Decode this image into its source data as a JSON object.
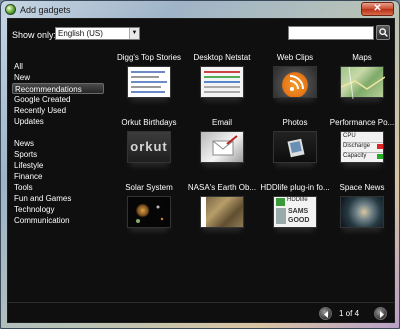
{
  "window": {
    "title": "Add gadgets",
    "close_glyph": "✕"
  },
  "toolbar": {
    "show_only_label": "Show only:",
    "language_value": "English (US)",
    "search_value": "",
    "search_icon": "magnifier-icon"
  },
  "categories": [
    {
      "label": "All",
      "active": false
    },
    {
      "label": "New",
      "active": false
    },
    {
      "label": "Recommendations",
      "active": true
    },
    {
      "label": "Google Created",
      "active": false
    },
    {
      "label": "Recently Used",
      "active": false
    },
    {
      "label": "Updates",
      "active": false
    },
    {
      "label": "News",
      "active": false
    },
    {
      "label": "Sports",
      "active": false
    },
    {
      "label": "Lifestyle",
      "active": false
    },
    {
      "label": "Finance",
      "active": false
    },
    {
      "label": "Tools",
      "active": false
    },
    {
      "label": "Fun and Games",
      "active": false
    },
    {
      "label": "Technology",
      "active": false
    },
    {
      "label": "Communication",
      "active": false
    }
  ],
  "gadgets": [
    {
      "name": "Digg's Top Stories"
    },
    {
      "name": "Desktop Netstat"
    },
    {
      "name": "Web Clips"
    },
    {
      "name": "Maps"
    },
    {
      "name": "Orkut Birthdays",
      "thumb_text": "orkut"
    },
    {
      "name": "Email"
    },
    {
      "name": "Photos"
    },
    {
      "name": "Performance Po...",
      "thumb_rows": [
        "CPU",
        "Discharge",
        "Capacity"
      ]
    },
    {
      "name": "Solar System"
    },
    {
      "name": "NASA's Earth Ob..."
    },
    {
      "name": "HDDlife plug-in fo...",
      "thumb_text": [
        "HDDlife",
        "SAMS",
        "GOOD"
      ]
    },
    {
      "name": "Space News"
    }
  ],
  "pagination": {
    "text": "1 of 4",
    "prev_icon": "prev-arrow-icon",
    "next_icon": "next-arrow-icon"
  }
}
